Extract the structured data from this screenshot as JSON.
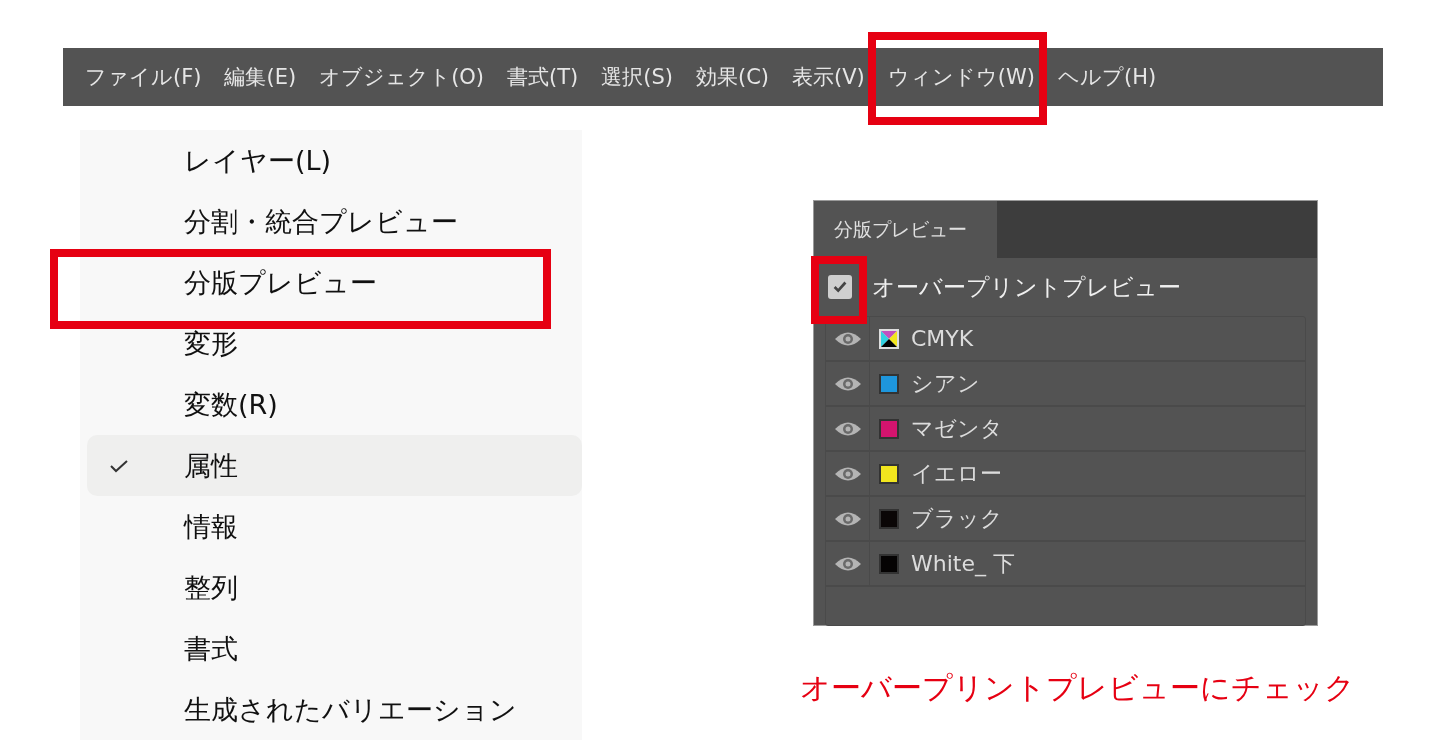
{
  "menubar": [
    {
      "label": "ファイル(F)",
      "highlighted": false
    },
    {
      "label": "編集(E)",
      "highlighted": false
    },
    {
      "label": "オブジェクト(O)",
      "highlighted": false
    },
    {
      "label": "書式(T)",
      "highlighted": false
    },
    {
      "label": "選択(S)",
      "highlighted": false
    },
    {
      "label": "効果(C)",
      "highlighted": false
    },
    {
      "label": "表示(V)",
      "highlighted": false
    },
    {
      "label": "ウィンドウ(W)",
      "highlighted": true
    },
    {
      "label": "ヘルプ(H)",
      "highlighted": false
    }
  ],
  "window_menu": [
    {
      "label": "レイヤー(L)",
      "checked": false,
      "highlighted": false
    },
    {
      "label": "分割・統合プレビュー",
      "checked": false,
      "highlighted": false
    },
    {
      "label": "分版プレビュー",
      "checked": false,
      "highlighted": true
    },
    {
      "label": "変形",
      "checked": false,
      "highlighted": false
    },
    {
      "label": "変数(R)",
      "checked": false,
      "highlighted": false
    },
    {
      "label": "属性",
      "checked": true,
      "highlighted": false
    },
    {
      "label": "情報",
      "checked": false,
      "highlighted": false
    },
    {
      "label": "整列",
      "checked": false,
      "highlighted": false
    },
    {
      "label": "書式",
      "checked": false,
      "highlighted": false
    },
    {
      "label": "生成されたバリエーション",
      "checked": false,
      "highlighted": false
    }
  ],
  "panel": {
    "tab": "分版プレビュー",
    "overprint": {
      "label": "オーバープリントプレビュー",
      "checked": true,
      "highlighted": true
    },
    "plates": [
      {
        "name": "CMYK",
        "kind": "composite",
        "visible": true
      },
      {
        "name": "シアン",
        "kind": "ink",
        "color": "#1e96dc",
        "visible": true
      },
      {
        "name": "マゼンタ",
        "kind": "ink",
        "color": "#d4146e",
        "visible": true
      },
      {
        "name": "イエロー",
        "kind": "ink",
        "color": "#f2e61e",
        "visible": true
      },
      {
        "name": "ブラック",
        "kind": "ink",
        "color": "#0a0606",
        "visible": true
      },
      {
        "name": "White_ 下",
        "kind": "ink",
        "color": "#050303",
        "visible": true
      }
    ]
  },
  "caption": "オーバープリントプレビューにチェック"
}
